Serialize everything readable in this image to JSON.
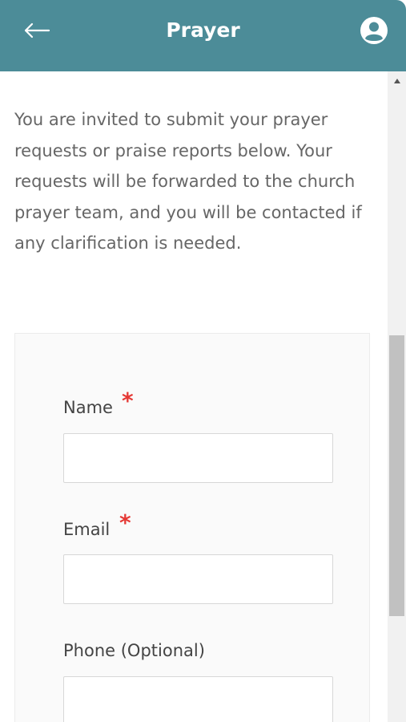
{
  "header": {
    "title": "Prayer"
  },
  "intro": {
    "text": "You are invited to submit your prayer requests or praise reports below. Your requests will be forwarded to the church prayer team, and you will be contacted if any clarification is needed."
  },
  "form": {
    "name": {
      "label": "Name",
      "required_mark": "*",
      "value": "",
      "placeholder": ""
    },
    "email": {
      "label": "Email",
      "required_mark": "*",
      "value": "",
      "placeholder": ""
    },
    "phone": {
      "label": "Phone (Optional)",
      "value": "",
      "placeholder": ""
    }
  },
  "icons": {
    "back": "arrow-left-icon",
    "account": "account-circle-icon",
    "scroll_up": "caret-up-icon"
  },
  "colors": {
    "header_bg": "#4c8c98",
    "required": "#e53935",
    "body_text": "#666666",
    "label_text": "#444444"
  }
}
